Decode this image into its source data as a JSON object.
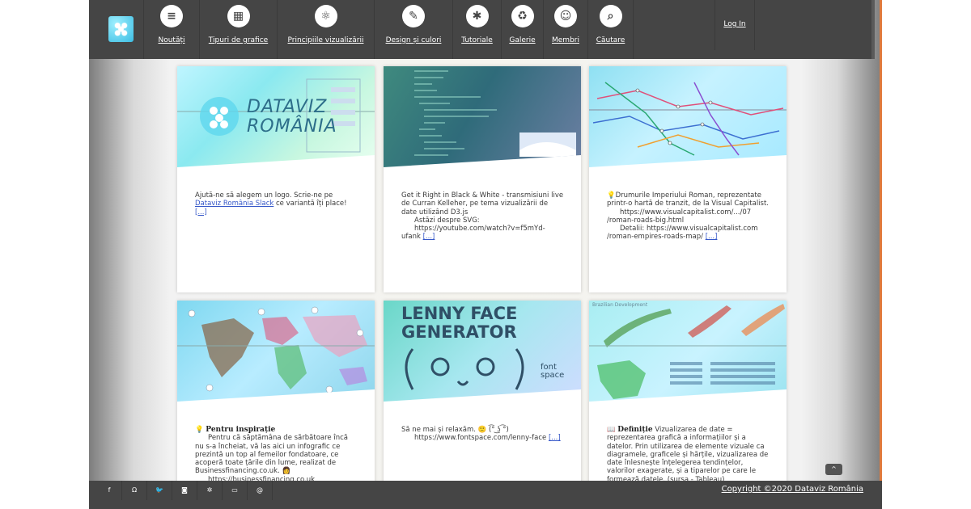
{
  "nav": {
    "items": [
      {
        "label": "Noutăți",
        "icon": "document-icon",
        "glyph": "≡"
      },
      {
        "label": "Tipuri de grafice",
        "icon": "grid-icon",
        "glyph": "▦"
      },
      {
        "label": "Principiile vizualizării",
        "icon": "atom-icon",
        "glyph": "⚛"
      },
      {
        "label": "Design și culori",
        "icon": "magic-wand-icon",
        "glyph": "✎"
      },
      {
        "label": "Tutoriale",
        "icon": "asterisk-icon",
        "glyph": "✱"
      },
      {
        "label": "Galerie",
        "icon": "piggy-bank-icon",
        "glyph": "♻"
      },
      {
        "label": "Membri",
        "icon": "users-icon",
        "glyph": "☺"
      },
      {
        "label": "Căutare",
        "icon": "search-icon",
        "glyph": "⌕"
      }
    ],
    "login_label": "Log In"
  },
  "cards": [
    {
      "thumb_title_1": "DATAVIZ",
      "thumb_title_2": "ROMÂNIA",
      "text_before": "Ajută-ne să alegem un logo. Scrie-ne pe ",
      "link": "Dataviz România Slack",
      "text_after": " ce variantă îți place!",
      "more": "[...]"
    },
    {
      "line1": "Get it Right in Black & White - transmisiuni live",
      "line2": "de Curran Kelleher, pe tema vizualizării de",
      "line3": "date utilizând D3.js",
      "line4": "Astăzi despre SVG:",
      "line5": "https://youtube.com/watch?v=f5mYd-",
      "line6": "ufank",
      "more": "[...]"
    },
    {
      "line1": "💡Drumurile Imperiului Roman, reprezentate",
      "line2": "printr-o hartă de tranzit, de la Visual Capitalist.",
      "line3": "https://www.visualcapitalist.com/.../07",
      "line4": "/roman-roads-big.html",
      "line5": "Detalii: https://www.visualcapitalist.com",
      "line6": "/roman-empires-roads-map/",
      "more": "[...]"
    },
    {
      "title": "Pentru inspirație",
      "line1": "Pentru că săptămâna de sărbătoare încă",
      "line2": "nu s-a încheiat, vă las aici un infografic ce",
      "line3": "prezintă un top al femeilor fondatoare, ce",
      "line4": "acoperă toate țările din lume, realizat de",
      "line5": "Businessfinancing.co.uk. 👩",
      "line6": "https://businessfinancing.co.uk"
    },
    {
      "thumb_title_1": "LENNY FACE",
      "thumb_title_2": "GENERATOR",
      "thumb_brand": "font space",
      "line1": "Să ne mai și relaxăm. 🙂 (͡° ͜ʖ ͡°)",
      "line2": "https://www.fontspace.com/lenny-face",
      "more": "[...]"
    },
    {
      "thumb_title": "Brazilian Development",
      "title": "Definiție",
      "line1": " Vizualizarea de date =",
      "line2": "reprezentarea grafică a informațiilor și a",
      "line3": "datelor. Prin utilizarea de elemente vizuale ca",
      "line4": "diagramele, graficele și hărțile, vizualizarea de",
      "line5": "date înlesnește înțelegerea tendințelor,",
      "line6": "valorilor exagerate, și a tiparelor pe care le",
      "line7": "formează datele. (sursa - Tableau)"
    }
  ],
  "footer": {
    "icons": [
      {
        "name": "facebook-icon",
        "glyph": "f"
      },
      {
        "name": "omega-icon",
        "glyph": "Ω"
      },
      {
        "name": "twitter-icon",
        "glyph": "🐦"
      },
      {
        "name": "instagram-icon",
        "glyph": "◙"
      },
      {
        "name": "slack-icon",
        "glyph": "✲"
      },
      {
        "name": "monitor-icon",
        "glyph": "▭"
      },
      {
        "name": "at-icon",
        "glyph": "@"
      }
    ],
    "copyright": "Copyright ©2020 Dataviz România",
    "to_top": "^"
  }
}
